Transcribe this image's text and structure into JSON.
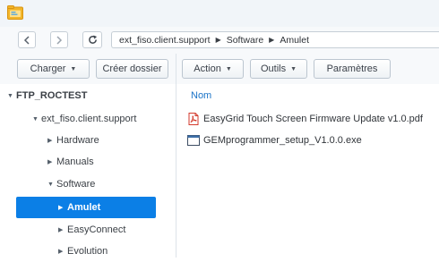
{
  "app": {
    "icon": "file-station-folder-icon"
  },
  "navigation": {
    "back_icon": "chevron-left-icon",
    "forward_icon": "chevron-right-icon",
    "refresh_icon": "refresh-icon",
    "breadcrumb": [
      {
        "label": "ext_fiso.client.support"
      },
      {
        "label": "Software"
      },
      {
        "label": "Amulet"
      }
    ],
    "separator": "▶"
  },
  "toolbar": {
    "upload_label": "Charger",
    "create_folder_label": "Créer dossier",
    "action_label": "Action",
    "tools_label": "Outils",
    "settings_label": "Paramètres"
  },
  "sidebar": {
    "root": {
      "label": "FTP_ROCTEST"
    },
    "share": {
      "label": "ext_fiso.client.support"
    },
    "folders": [
      {
        "label": "Hardware",
        "expanded": false,
        "selected": false
      },
      {
        "label": "Manuals",
        "expanded": false,
        "selected": false
      },
      {
        "label": "Software",
        "expanded": true,
        "selected": false
      },
      {
        "label": "Amulet",
        "expanded": false,
        "selected": true
      },
      {
        "label": "EasyConnect",
        "expanded": false,
        "selected": false
      },
      {
        "label": "Evolution",
        "expanded": false,
        "selected": false
      }
    ]
  },
  "file_list": {
    "column_name": "Nom",
    "files": [
      {
        "name": "EasyGrid Touch Screen Firmware Update v1.0.pdf",
        "icon": "pdf-file-icon"
      },
      {
        "name": "GEMprogrammer_setup_V1.0.0.exe",
        "icon": "exe-file-icon"
      }
    ]
  },
  "colors": {
    "accent": "#0b7fe6",
    "link": "#1a73c7",
    "folder": "#f0b429"
  }
}
